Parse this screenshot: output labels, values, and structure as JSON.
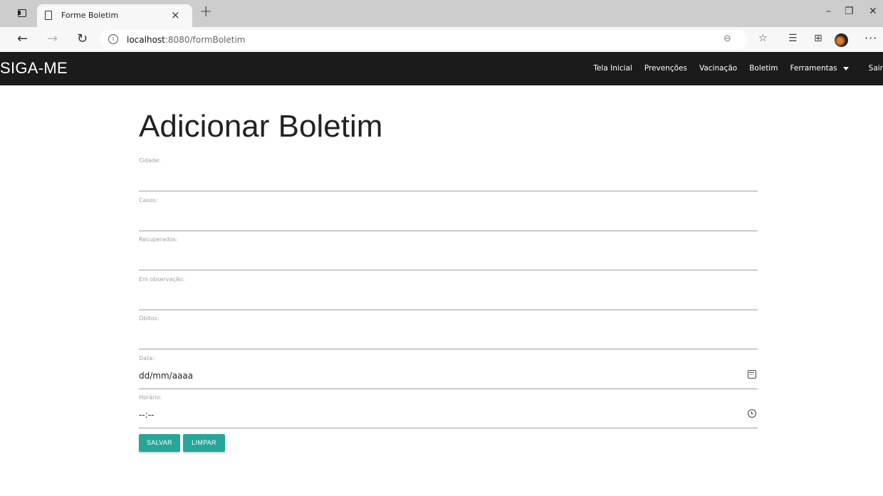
{
  "browser": {
    "tab_title": "Forme Boletim",
    "tab_close": "×",
    "new_tab": "+",
    "url_host": "localhost",
    "url_rest": ":8080/formBoletim",
    "win_min": "–",
    "win_restore": "❐",
    "win_close": "✕"
  },
  "navbar": {
    "brand": "SIGA-ME",
    "links": [
      "Tela Inicial",
      "Prevenções",
      "Vacinação",
      "Boletim",
      "Ferramentas",
      "Sair"
    ]
  },
  "form": {
    "title": "Adicionar Boletim",
    "fields": [
      {
        "label": "Cidade:",
        "value": ""
      },
      {
        "label": "Casos:",
        "value": ""
      },
      {
        "label": "Recuperados:",
        "value": ""
      },
      {
        "label": "Em observação:",
        "value": ""
      },
      {
        "label": "Óbitos:",
        "value": ""
      },
      {
        "label": "Data:",
        "value": "dd/mm/aaaa"
      },
      {
        "label": "Horário:",
        "value": "--:--"
      }
    ],
    "buttons": {
      "save": "SALVAR",
      "clear": "LIMPAR"
    }
  },
  "icons": {
    "date": "calendar-icon",
    "time": "clock-icon"
  },
  "colors": {
    "navbar_bg": "#1b1b1b",
    "button_bg": "#26a69a"
  }
}
